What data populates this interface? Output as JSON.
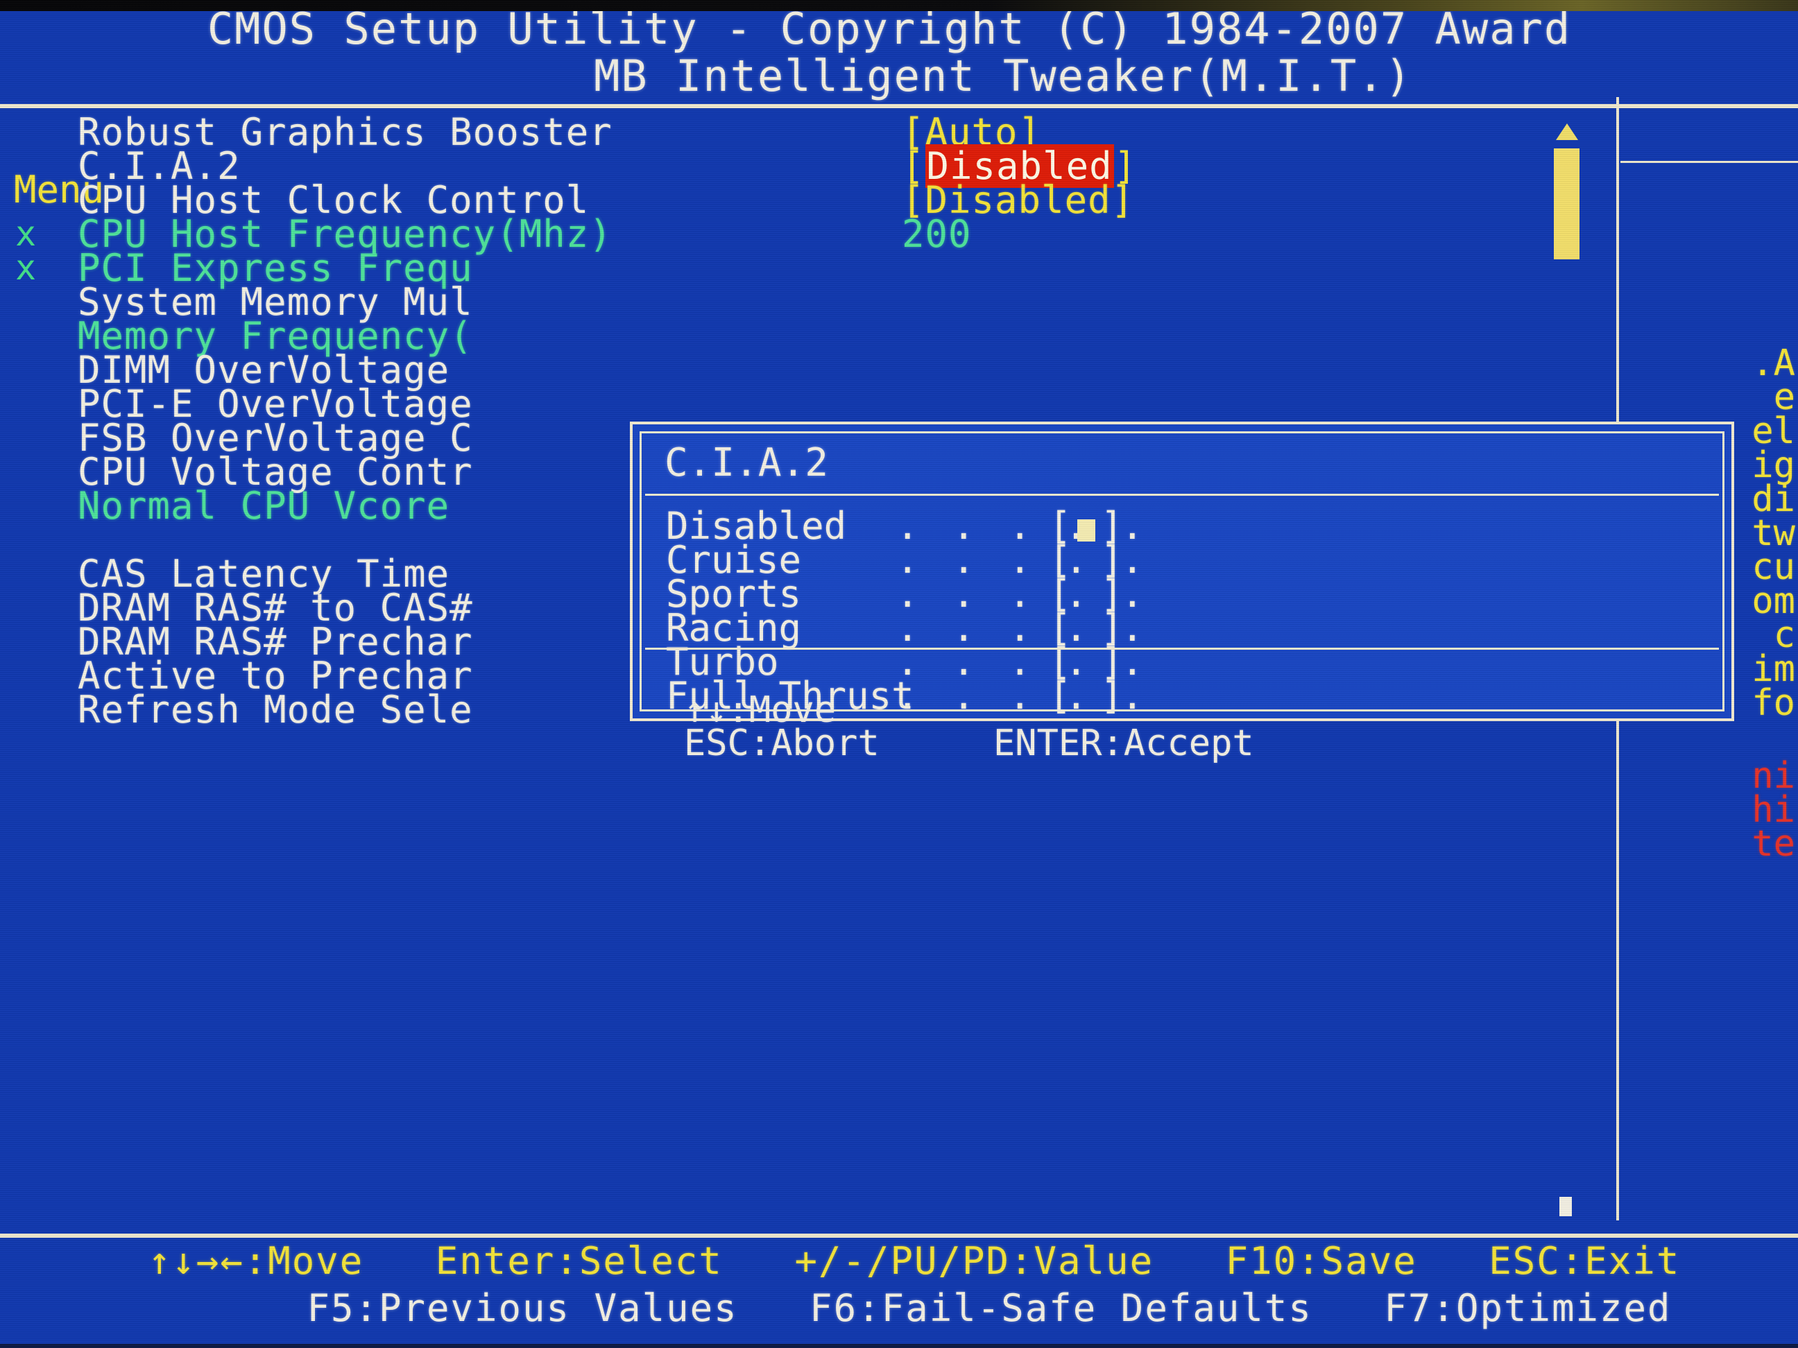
{
  "header": {
    "line1": "CMOS Setup Utility - Copyright (C) 1984-2007 Award",
    "line2": "MB Intelligent Tweaker(M.I.T.)"
  },
  "options": [
    {
      "mark": "",
      "label": "Robust Graphics Booster",
      "label_color": "white",
      "value": "[Auto]",
      "value_style": "yellow"
    },
    {
      "mark": "",
      "label": "C.I.A.2",
      "label_color": "white",
      "value": "[Disabled]",
      "value_style": "yellow-red-highlight"
    },
    {
      "mark": "",
      "label": "CPU Host Clock Control",
      "label_color": "white",
      "value": "[Disabled]",
      "value_style": "yellow"
    },
    {
      "mark": "x",
      "label": "CPU Host Frequency(Mhz)",
      "label_color": "cyan",
      "value": "200",
      "value_style": "cyan"
    },
    {
      "mark": "x",
      "label": "PCI Express Frequ",
      "label_color": "cyan",
      "value": "",
      "value_style": "cyan"
    },
    {
      "mark": "",
      "label": "System Memory Mul",
      "label_color": "white",
      "value": "",
      "value_style": "yellow"
    },
    {
      "mark": "",
      "label": "Memory Frequency(",
      "label_color": "cyan",
      "value": "",
      "value_style": "cyan"
    },
    {
      "mark": "",
      "label": "DIMM OverVoltage",
      "label_color": "white",
      "value": "",
      "value_style": "yellow"
    },
    {
      "mark": "",
      "label": "PCI-E OverVoltage",
      "label_color": "white",
      "value": "",
      "value_style": "yellow"
    },
    {
      "mark": "",
      "label": "FSB OverVoltage C",
      "label_color": "white",
      "value": "",
      "value_style": "yellow"
    },
    {
      "mark": "",
      "label": "CPU Voltage Contr",
      "label_color": "white",
      "value": "",
      "value_style": "yellow"
    },
    {
      "mark": "",
      "label": "Normal CPU Vcore",
      "label_color": "cyan",
      "value": "",
      "value_style": "cyan"
    },
    {
      "mark": "",
      "label": "",
      "label_color": "white",
      "value": "",
      "value_style": "yellow"
    },
    {
      "mark": "",
      "label": "CAS Latency Time",
      "label_color": "white",
      "value": "",
      "value_style": "yellow"
    },
    {
      "mark": "",
      "label": "DRAM RAS# to CAS#",
      "label_color": "white",
      "value": "",
      "value_style": "yellow"
    },
    {
      "mark": "",
      "label": "DRAM RAS# Prechar",
      "label_color": "white",
      "value": "",
      "value_style": "yellow"
    },
    {
      "mark": "",
      "label": "Active to Prechar",
      "label_color": "white",
      "value": "",
      "value_style": "yellow"
    },
    {
      "mark": "",
      "label": "Refresh Mode Sele",
      "label_color": "white",
      "value": "",
      "value_style": "yellow"
    }
  ],
  "right_panel": {
    "menu_label": "Menu",
    "help_lines": [
      ".A",
      "e",
      "el",
      "ig",
      "di",
      "tw",
      "cu",
      "om",
      "c",
      "im",
      "fo"
    ],
    "warning_lines": [
      "ni",
      "hi",
      "te"
    ]
  },
  "dialog": {
    "title": "C.I.A.2",
    "dots": ". . . . .",
    "options": [
      {
        "name": "Disabled",
        "selected": true
      },
      {
        "name": "Cruise",
        "selected": false
      },
      {
        "name": "Sports",
        "selected": false
      },
      {
        "name": "Racing",
        "selected": false
      },
      {
        "name": "Turbo",
        "selected": false
      },
      {
        "name": "Full Thrust",
        "selected": false
      }
    ],
    "footer": {
      "move": "↑↓:Move",
      "accept": "ENTER:Accept",
      "abort": "ESC:Abort"
    }
  },
  "statusbar": {
    "line1": "↑↓→←:Move   Enter:Select   +/-/PU/PD:Value   F10:Save   ESC:Exit",
    "line2": "F5:Previous Values   F6:Fail-Safe Defaults   F7:Optimized"
  },
  "colors": {
    "background": "#1139b0",
    "panel_background": "#1a47c4",
    "text_white": "#f4f1e4",
    "text_yellow": "#f5e53a",
    "text_cyan": "#4fe39c",
    "highlight_red": "#e01d08",
    "warning_red": "#e8332a",
    "rule": "#efe9cf",
    "scrollbar_thumb": "#f4e06c"
  }
}
